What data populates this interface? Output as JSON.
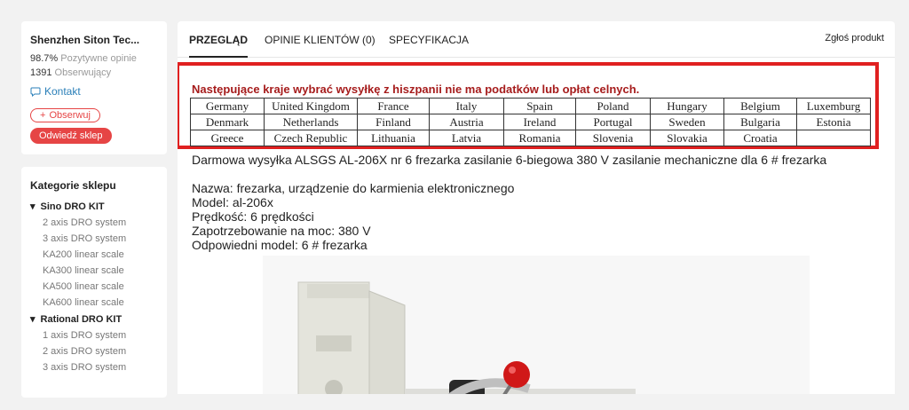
{
  "store": {
    "name": "Shenzhen Siton Tec...",
    "positive_value": "98.7%",
    "positive_label": "Pozytywne opinie",
    "followers_value": "1391",
    "followers_label": "Obserwujący",
    "contact_label": "Kontakt",
    "follow_label": "Obserwuj",
    "visit_label": "Odwiedź sklep"
  },
  "categories": {
    "title": "Kategorie sklepu",
    "groups": [
      {
        "label": "Sino DRO KIT",
        "items": [
          "2 axis DRO system",
          "3 axis DRO system",
          "KA200 linear scale",
          "KA300 linear scale",
          "KA500 linear scale",
          "KA600 linear scale"
        ]
      },
      {
        "label": "Rational DRO KIT",
        "items": [
          "1 axis DRO system",
          "2 axis DRO system",
          "3 axis DRO system"
        ]
      }
    ]
  },
  "tabs": [
    {
      "label": "PRZEGLĄD"
    },
    {
      "label": "OPINIE KLIENTÓW (0)"
    },
    {
      "label": "SPECYFIKACJA"
    }
  ],
  "report_label": "Zgłoś produkt",
  "shipping_notice": {
    "title": "Następujące kraje wybrać wysyłkę z hiszpanii nie ma podatków lub opłat celnych.",
    "rows": [
      [
        "Germany",
        "United Kingdom",
        "France",
        "Italy",
        "Spain",
        "Poland",
        "Hungary",
        "Belgium",
        "Luxemburg"
      ],
      [
        "Denmark",
        "Netherlands",
        "Finland",
        "Austria",
        "Ireland",
        "Portugal",
        "Sweden",
        "Bulgaria",
        "Estonia"
      ],
      [
        "Greece",
        "Czech Republic",
        "Lithuania",
        "Latvia",
        "Romania",
        "Slovenia",
        "Slovakia",
        "Croatia",
        ""
      ]
    ]
  },
  "description": {
    "headline": "Darmowa wysyłka ALSGS AL-206X nr 6 frezarka zasilanie 6-biegowa 380 V zasilanie mechaniczne dla 6 # frezarka",
    "lines": [
      "Nazwa: frezarka, urządzenie do karmienia elektronicznego",
      "Model: al-206x",
      "Prędkość: 6 prędkości",
      "Zapotrzebowanie na moc: 380 V",
      "Odpowiedni model: 6 # frezarka"
    ]
  },
  "colors": {
    "accent_red": "#e64545",
    "notice_border": "#e02020",
    "notice_title": "#a61c1c",
    "link_blue": "#2a7fb8"
  }
}
